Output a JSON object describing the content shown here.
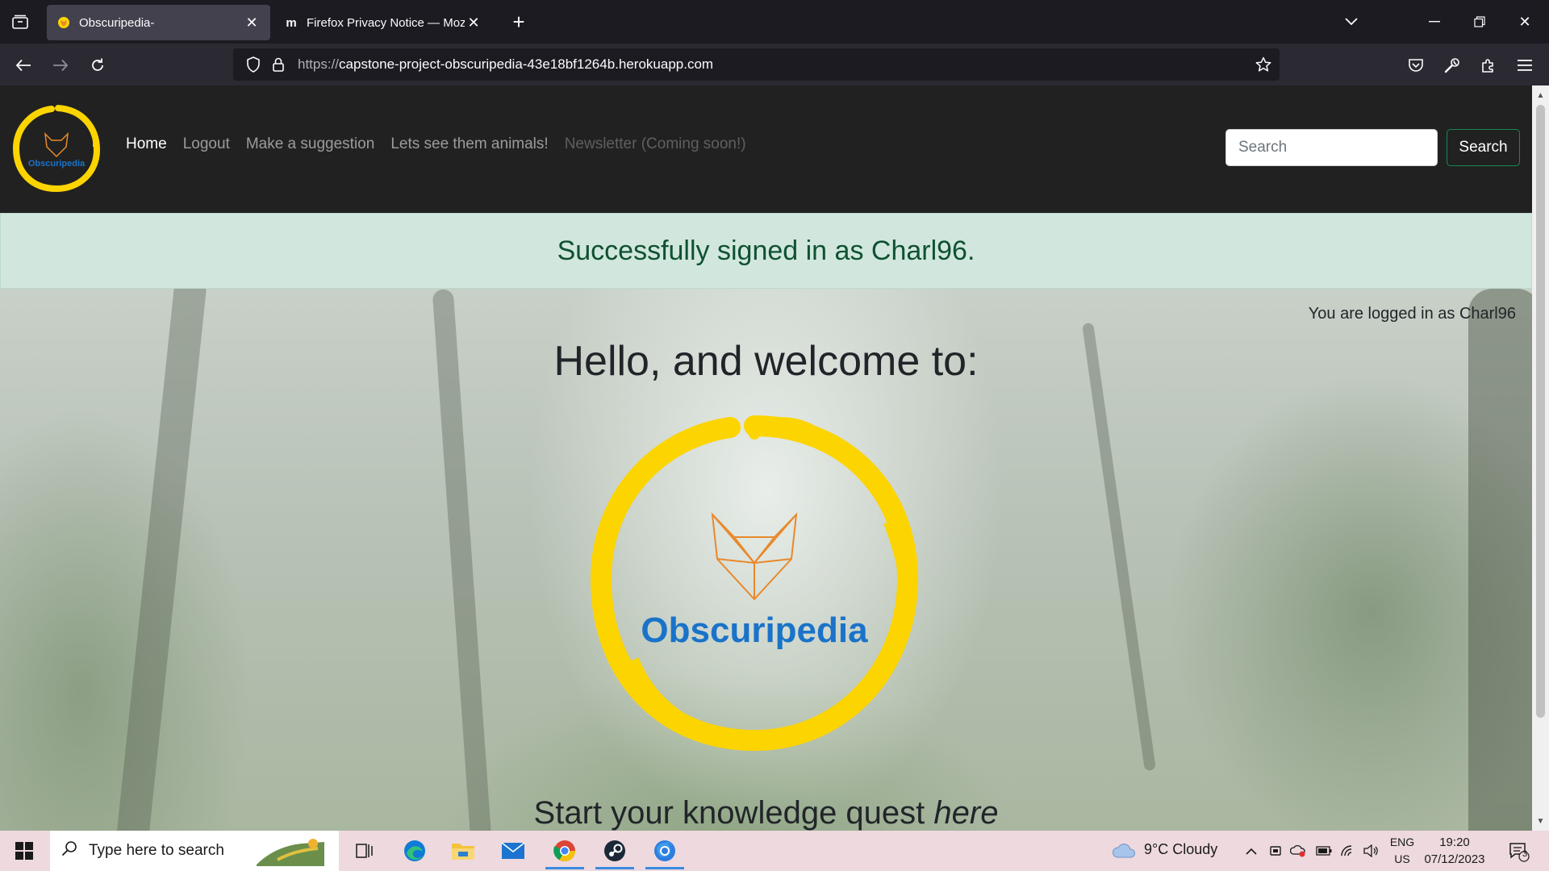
{
  "browser": {
    "tabs": [
      {
        "title": "Obscuripedia-",
        "favicon": "fox-favicon"
      },
      {
        "title": "Firefox Privacy Notice — Mozill",
        "favicon": "m"
      }
    ],
    "url_protocol": "https://",
    "url_host": "capstone-project-obscuripedia-43e18bf1264b.herokuapp.com"
  },
  "site": {
    "logo_text": "Obscuripedia",
    "nav": {
      "home": "Home",
      "logout": "Logout",
      "suggest": "Make a suggestion",
      "animals": "Lets see them animals!",
      "newsletter": "Newsletter (Coming soon!)"
    },
    "search": {
      "placeholder": "Search",
      "button": "Search"
    },
    "alert": "Successfully signed in as Charl96.",
    "logged_in": "You are logged in as Charl96",
    "welcome": "Hello, and welcome to:",
    "brand": "Obscuripedia",
    "quest_prefix": "Start your knowledge quest ",
    "quest_link": "here"
  },
  "taskbar": {
    "search_placeholder": "Type here to search",
    "weather": "9°C  Cloudy",
    "lang_top": "ENG",
    "lang_bottom": "US",
    "time": "19:20",
    "date": "07/12/2023",
    "notification_count": "3"
  },
  "colors": {
    "nav_bg": "#212121",
    "alert_bg": "#d1e7dd",
    "alert_text": "#0f5132",
    "logo_yellow": "#fcd400",
    "logo_blue": "#1a73c9",
    "fox_orange": "#e8892b",
    "search_btn_border": "#198754"
  }
}
